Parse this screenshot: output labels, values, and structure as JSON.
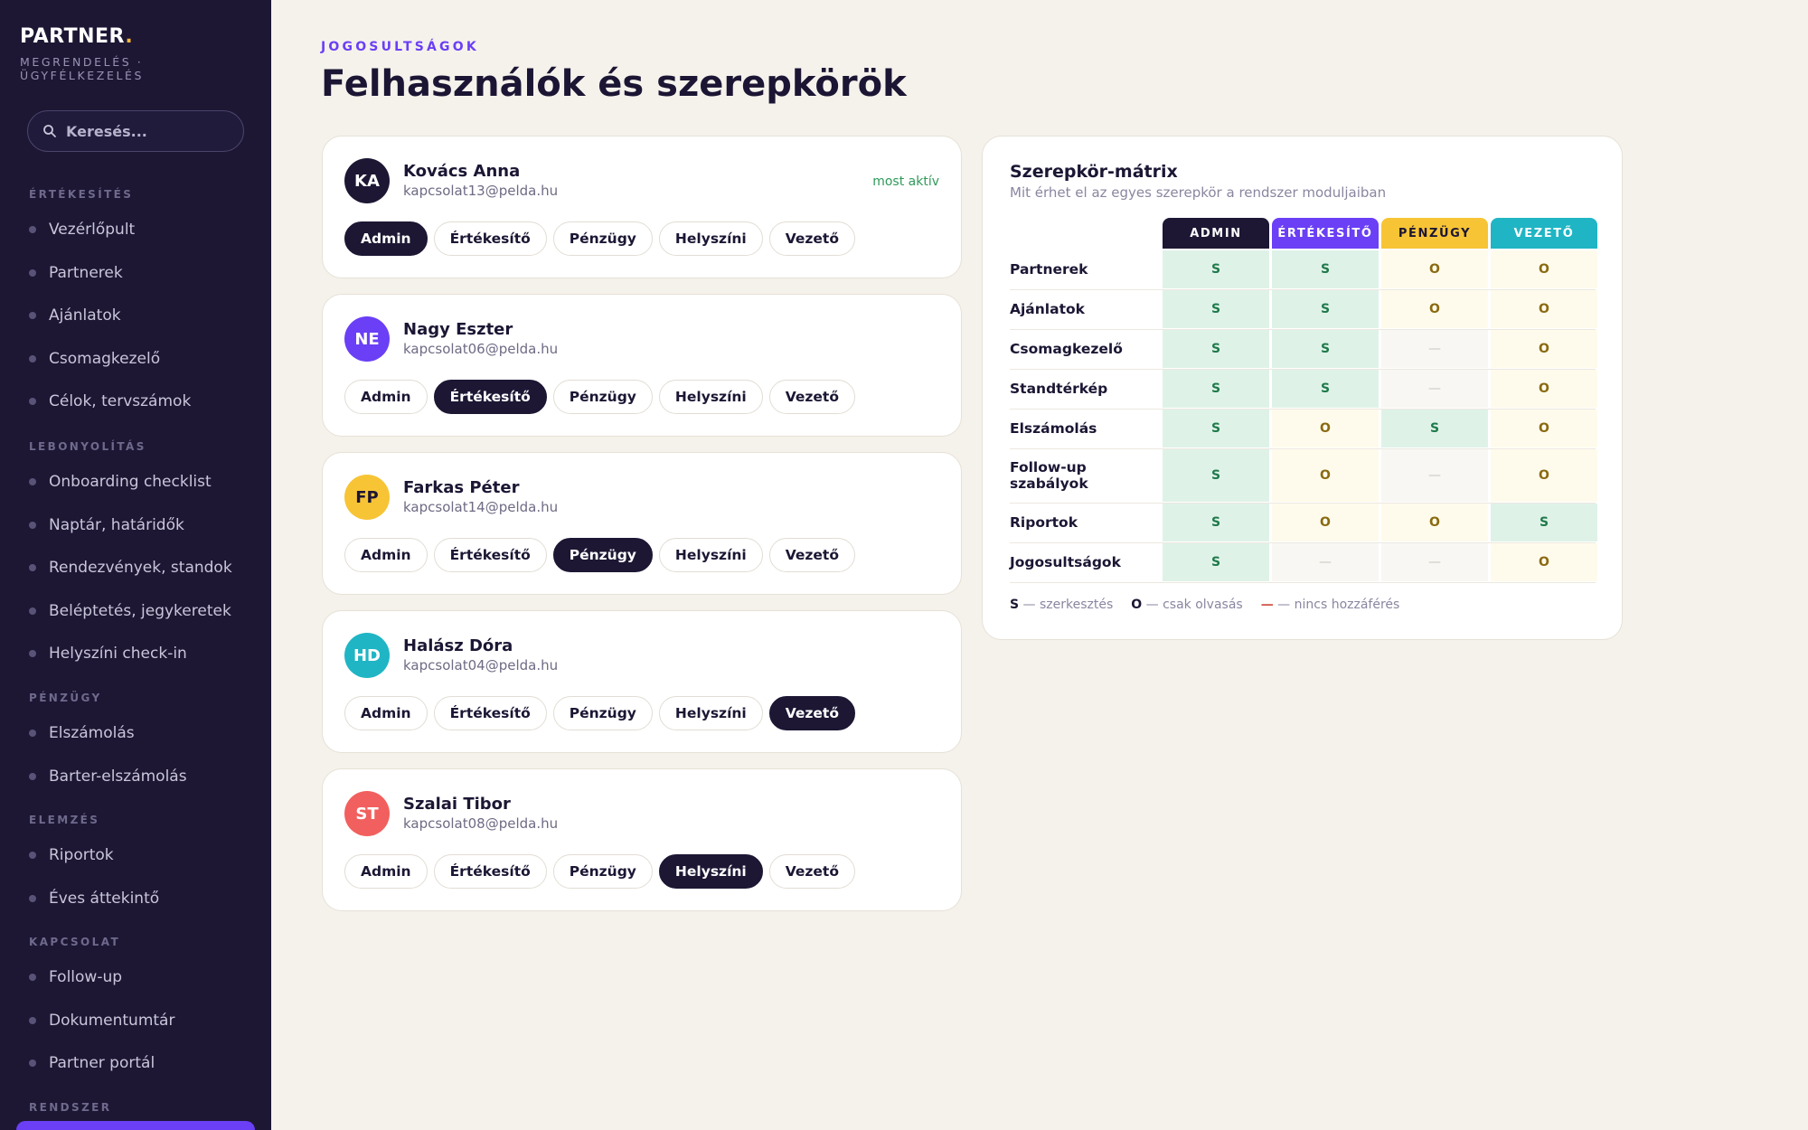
{
  "sidebar": {
    "brand": "PARTNER",
    "brand_dot": ".",
    "subtitle": "MEGRENDELÉS · ÜGYFÉLKEZELÉS",
    "search_placeholder": "Keresés...",
    "sections": [
      {
        "title": "ÉRTÉKESÍTÉS",
        "items": [
          "Vezérlőpult",
          "Partnerek",
          "Ajánlatok",
          "Csomagkezelő",
          "Célok, tervszámok"
        ]
      },
      {
        "title": "LEBONYOLÍTÁS",
        "items": [
          "Onboarding checklist",
          "Naptár, határidők",
          "Rendezvények, standok",
          "Beléptetés, jegykeretek",
          "Helyszíni check-in"
        ]
      },
      {
        "title": "PÉNZÜGY",
        "items": [
          "Elszámolás",
          "Barter-elszámolás"
        ]
      },
      {
        "title": "ELEMZÉS",
        "items": [
          "Riportok",
          "Éves áttekintő"
        ]
      },
      {
        "title": "KAPCSOLAT",
        "items": [
          "Follow-up",
          "Dokumentumtár",
          "Partner portál"
        ]
      },
      {
        "title": "RENDSZER",
        "items": []
      }
    ]
  },
  "header": {
    "eyebrow": "JOGOSULTSÁGOK",
    "title": "Felhasználók és szerepkörök"
  },
  "roles": [
    "Admin",
    "Értékesítő",
    "Pénzügy",
    "Helyszíni",
    "Vezető"
  ],
  "users": [
    {
      "initials": "KA",
      "name": "Kovács Anna",
      "email": "kapcsolat13@pelda.hu",
      "status": "most aktív",
      "active_role": 0,
      "avatar_color": "#1d1734"
    },
    {
      "initials": "NE",
      "name": "Nagy Eszter",
      "email": "kapcsolat06@pelda.hu",
      "status": "",
      "active_role": 1,
      "avatar_color": "#6a3ff5"
    },
    {
      "initials": "FP",
      "name": "Farkas Péter",
      "email": "kapcsolat14@pelda.hu",
      "status": "",
      "active_role": 2,
      "avatar_color": "#f7c436"
    },
    {
      "initials": "HD",
      "name": "Halász Dóra",
      "email": "kapcsolat04@pelda.hu",
      "status": "",
      "active_role": 4,
      "avatar_color": "#1fb5c4"
    },
    {
      "initials": "ST",
      "name": "Szalai Tibor",
      "email": "kapcsolat08@pelda.hu",
      "status": "",
      "active_role": 3,
      "avatar_color": "#f1605e"
    }
  ],
  "matrix": {
    "title": "Szerepkör-mátrix",
    "subtitle": "Mit érhet el az egyes szerepkör a rendszer moduljaiban",
    "columns": [
      {
        "label": "ADMIN",
        "bg": "#1d1734",
        "fg": "#ffffff"
      },
      {
        "label": "ÉRTÉKESÍTŐ",
        "bg": "#6a3ff5",
        "fg": "#ffffff"
      },
      {
        "label": "PÉNZÜGY",
        "bg": "#f7c436",
        "fg": "#1c1634"
      },
      {
        "label": "VEZETŐ",
        "bg": "#1fb5c4",
        "fg": "#ffffff"
      }
    ],
    "rows": [
      {
        "label": "Partnerek",
        "cells": [
          "S",
          "S",
          "O",
          "O"
        ]
      },
      {
        "label": "Ajánlatok",
        "cells": [
          "S",
          "S",
          "O",
          "O"
        ]
      },
      {
        "label": "Csomagkezelő",
        "cells": [
          "S",
          "S",
          "—",
          "O"
        ]
      },
      {
        "label": "Standtérkép",
        "cells": [
          "S",
          "S",
          "—",
          "O"
        ]
      },
      {
        "label": "Elszámolás",
        "cells": [
          "S",
          "O",
          "S",
          "O"
        ]
      },
      {
        "label": "Follow-up szabályok",
        "cells": [
          "S",
          "O",
          "—",
          "O"
        ]
      },
      {
        "label": "Riportok",
        "cells": [
          "S",
          "O",
          "O",
          "S"
        ]
      },
      {
        "label": "Jogosultságok",
        "cells": [
          "S",
          "—",
          "—",
          "O"
        ]
      }
    ],
    "legend": [
      {
        "key": "S",
        "text": "— szerkesztés"
      },
      {
        "key": "O",
        "text": "— csak olvasás"
      },
      {
        "key": "—",
        "text": "— nincs hozzáférés"
      }
    ]
  }
}
